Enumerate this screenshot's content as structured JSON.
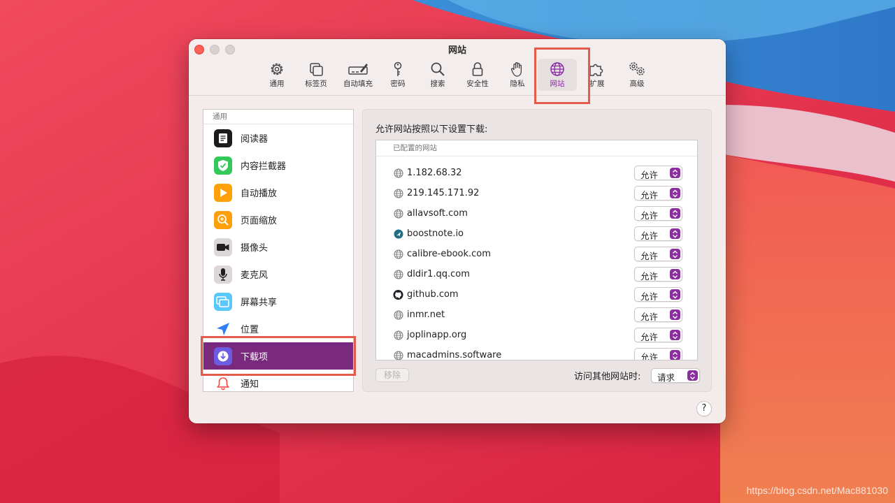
{
  "window": {
    "title": "网站"
  },
  "toolbar": {
    "tabs": [
      {
        "label": "通用",
        "icon": "gear-icon"
      },
      {
        "label": "标签页",
        "icon": "tabs-icon"
      },
      {
        "label": "自动填充",
        "icon": "pencil-field-icon"
      },
      {
        "label": "密码",
        "icon": "key-icon"
      },
      {
        "label": "搜索",
        "icon": "magnifier-icon"
      },
      {
        "label": "安全性",
        "icon": "lock-icon"
      },
      {
        "label": "隐私",
        "icon": "hand-icon"
      },
      {
        "label": "网站",
        "icon": "globe-icon",
        "selected": true
      },
      {
        "label": "扩展",
        "icon": "puzzle-icon"
      },
      {
        "label": "高级",
        "icon": "gears-icon"
      }
    ]
  },
  "sidebar": {
    "header": "通用",
    "items": [
      {
        "label": "阅读器",
        "icon": "reader-icon",
        "color": "#1c1c1e"
      },
      {
        "label": "内容拦截器",
        "icon": "shield-check-icon",
        "color": "#34c759"
      },
      {
        "label": "自动播放",
        "icon": "play-icon",
        "color": "#ff9f0a"
      },
      {
        "label": "页面缩放",
        "icon": "zoom-icon",
        "color": "#ff9f0a"
      },
      {
        "label": "摄像头",
        "icon": "camera-icon",
        "color": "#d9d4d4"
      },
      {
        "label": "麦克风",
        "icon": "microphone-icon",
        "color": "#d9d4d4"
      },
      {
        "label": "屏幕共享",
        "icon": "screen-share-icon",
        "color": "#5ac8fa"
      },
      {
        "label": "位置",
        "icon": "location-icon",
        "color": "#2f7ef6"
      },
      {
        "label": "下载项",
        "icon": "download-icon",
        "color": "#5e5ce6",
        "selected": true
      },
      {
        "label": "通知",
        "icon": "bell-icon",
        "color": "#ff453a"
      }
    ]
  },
  "panel": {
    "heading": "允许网站按照以下设置下载:",
    "table_header": "已配置的网站",
    "sites": [
      {
        "domain": "1.182.68.32",
        "icon": "globe-icon",
        "value": "允许"
      },
      {
        "domain": "219.145.171.92",
        "icon": "globe-icon",
        "value": "允许"
      },
      {
        "domain": "allavsoft.com",
        "icon": "globe-icon",
        "value": "允许"
      },
      {
        "domain": "boostnote.io",
        "icon": "boostnote-favicon",
        "value": "允许"
      },
      {
        "domain": "calibre-ebook.com",
        "icon": "globe-icon",
        "value": "允许"
      },
      {
        "domain": "dldir1.qq.com",
        "icon": "globe-icon",
        "value": "允许"
      },
      {
        "domain": "github.com",
        "icon": "github-icon",
        "value": "允许"
      },
      {
        "domain": "inmr.net",
        "icon": "globe-icon",
        "value": "允许"
      },
      {
        "domain": "joplinapp.org",
        "icon": "globe-icon",
        "value": "允许"
      },
      {
        "domain": "macadmins.software",
        "icon": "globe-icon",
        "value": "允许"
      }
    ],
    "remove_label": "移除",
    "other_sites_label": "访问其他网站时:",
    "other_sites_value": "请求"
  },
  "help_label": "?",
  "watermark": "https://blog.csdn.net/Mac881030",
  "colors": {
    "accent": "#8b2f9e",
    "selection": "#7a2a7e",
    "annotation": "#e25b4b"
  }
}
